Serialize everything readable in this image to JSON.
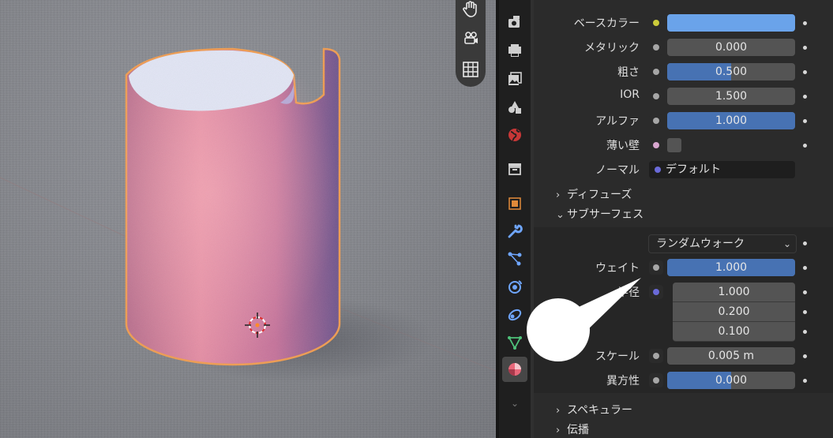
{
  "properties": {
    "base_color": {
      "label": "ベースカラー",
      "color": "#6aa3ea"
    },
    "metallic": {
      "label": "メタリック",
      "value": "0.000",
      "fraction": 0.0
    },
    "roughness": {
      "label": "粗さ",
      "value": "0.500",
      "fraction": 0.5
    },
    "ior": {
      "label": "IOR",
      "value": "1.500",
      "fraction": 0.0
    },
    "alpha": {
      "label": "アルファ",
      "value": "1.000",
      "fraction": 1.0
    },
    "thin_wall": {
      "label": "薄い壁"
    },
    "normal": {
      "label": "ノーマル",
      "value": "デフォルト"
    },
    "panels": {
      "diffuse": "ディフューズ",
      "subsurface": "サブサーフェス",
      "specular": "スペキュラー",
      "transmission": "伝播"
    },
    "subsurface": {
      "method": "ランダムウォーク",
      "weight": {
        "label": "ウェイト",
        "value": "1.000",
        "fraction": 1.0
      },
      "radius": {
        "label": "半径",
        "values": [
          "1.000",
          "0.200",
          "0.100"
        ]
      },
      "scale": {
        "label": "スケール",
        "value": "0.005 m",
        "fraction": 0.0
      },
      "anisotropy": {
        "label": "異方性",
        "value": "0.000",
        "fraction": 0.5
      }
    }
  },
  "icons": {
    "viewport_tools": [
      "hand-icon",
      "camera-icon",
      "grid-icon"
    ],
    "tabs": [
      "render-icon",
      "output-icon",
      "view-layer-icon",
      "scene-icon",
      "world-icon",
      "collection-icon",
      "object-icon",
      "modifier-icon",
      "particles-icon",
      "physics-icon",
      "constraints-icon",
      "data-icon",
      "material-icon"
    ]
  },
  "colors": {
    "accent": "#4772b3",
    "selection_outline": "#f29a4a",
    "material_pink": "#e87a9a"
  }
}
